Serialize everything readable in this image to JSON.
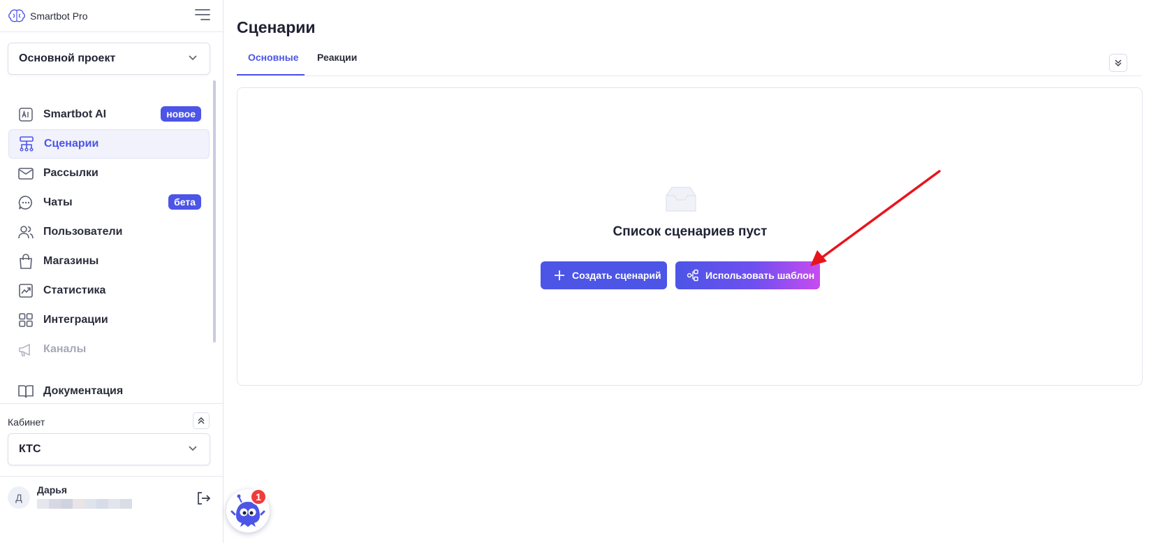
{
  "app": {
    "name": "Smartbot Pro"
  },
  "project_select": {
    "value": "Основной проект"
  },
  "sidebar": {
    "items": [
      {
        "label": "Smartbot AI",
        "icon": "ai-icon",
        "badge": "новое"
      },
      {
        "label": "Сценарии",
        "icon": "scenarios-icon",
        "active": true
      },
      {
        "label": "Рассылки",
        "icon": "mail-icon"
      },
      {
        "label": "Чаты",
        "icon": "chat-icon",
        "badge": "бета"
      },
      {
        "label": "Пользователи",
        "icon": "users-icon"
      },
      {
        "label": "Магазины",
        "icon": "shop-bag-icon"
      },
      {
        "label": "Статистика",
        "icon": "stats-icon"
      },
      {
        "label": "Интеграции",
        "icon": "integrations-icon"
      },
      {
        "label": "Каналы",
        "icon": "megaphone-icon"
      },
      {
        "label": "Документация",
        "icon": "book-icon"
      }
    ],
    "cabinet_label": "Кабинет",
    "cabinet_value": "КТС",
    "user_initial": "Д",
    "user_name": "Дарья"
  },
  "main": {
    "title": "Сценарии",
    "tabs": [
      {
        "label": "Основные",
        "active": true
      },
      {
        "label": "Реакции"
      }
    ],
    "empty_text": "Список сценариев пуст",
    "create_button": "Создать сценарий",
    "template_button": "Использовать шаблон"
  },
  "notification_count": "1",
  "colors": {
    "accent": "#4c55e6",
    "gradient_end": "#c84cf0",
    "arrow": "#e8141c",
    "badge_red": "#f03c3c"
  }
}
